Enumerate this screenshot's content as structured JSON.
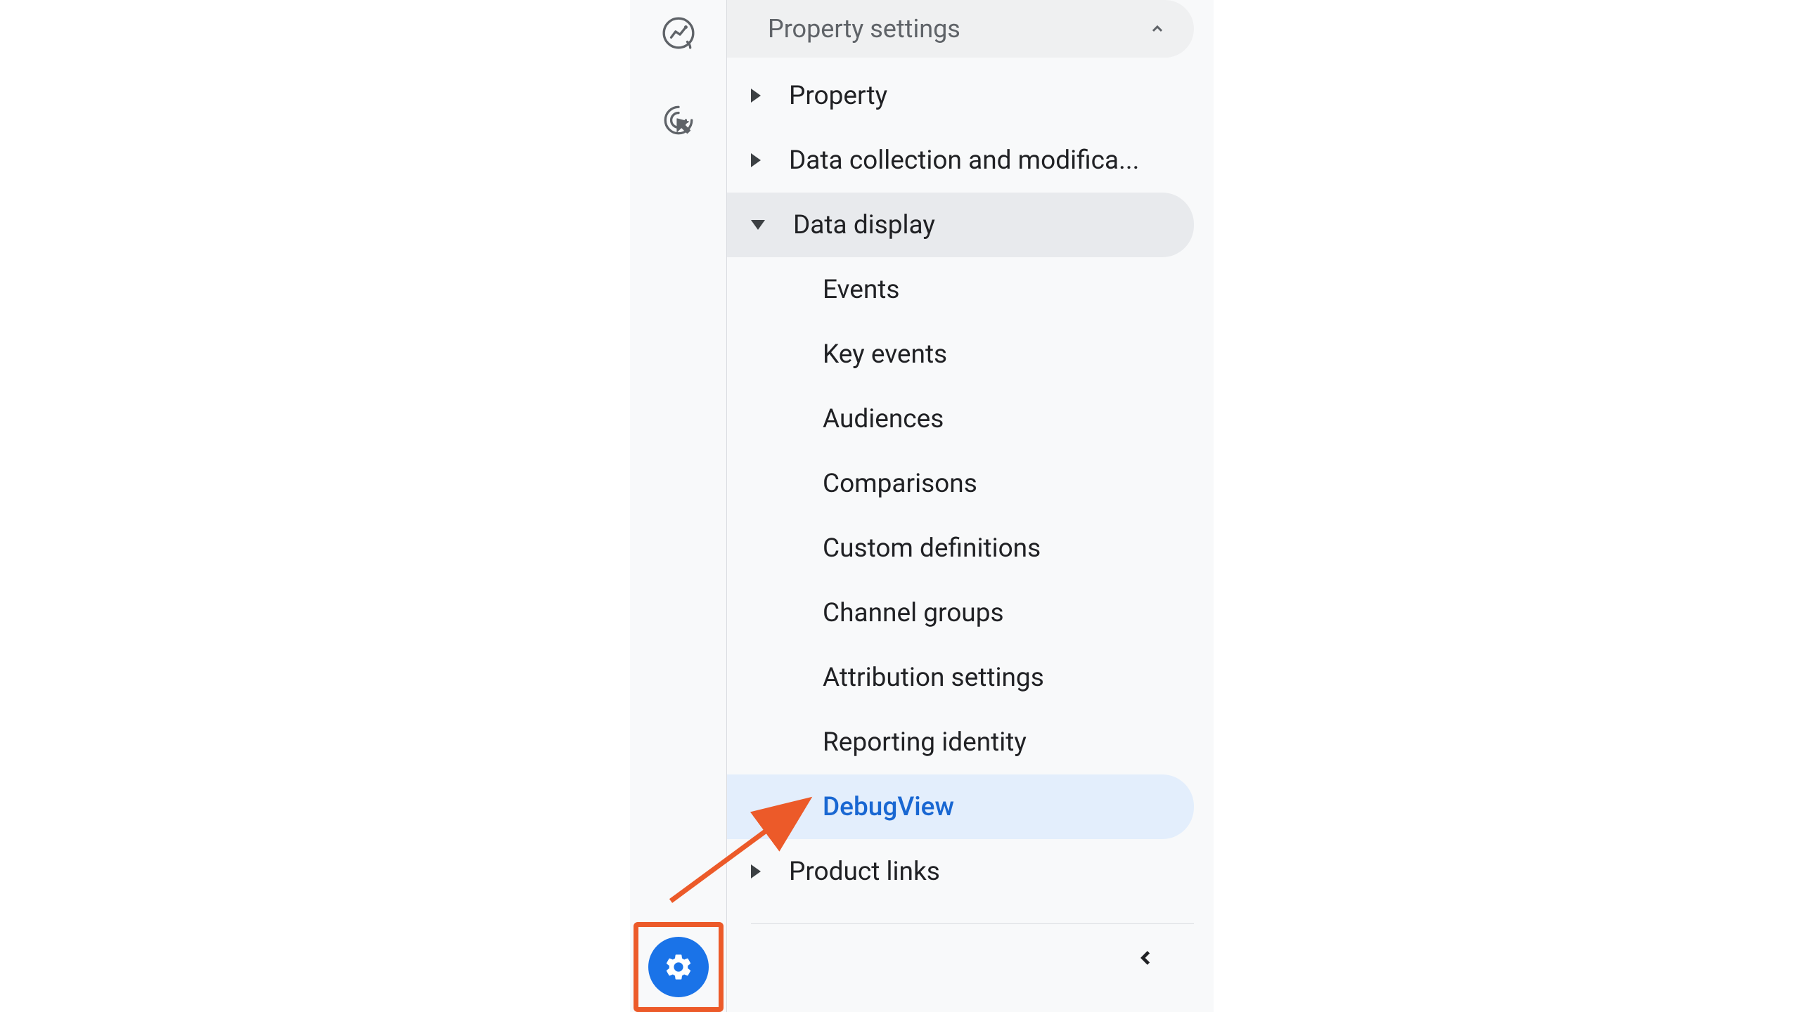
{
  "section_header": "Property settings",
  "nav": {
    "property": "Property",
    "data_collection": "Data collection and modifica...",
    "data_display": "Data display",
    "product_links": "Product links"
  },
  "data_display_items": {
    "events": "Events",
    "key_events": "Key events",
    "audiences": "Audiences",
    "comparisons": "Comparisons",
    "custom_definitions": "Custom definitions",
    "channel_groups": "Channel groups",
    "attribution_settings": "Attribution settings",
    "reporting_identity": "Reporting identity",
    "debugview": "DebugView"
  },
  "colors": {
    "highlight_orange": "#ec5a29",
    "accent_blue": "#1a73e8",
    "link_blue": "#1967d2"
  }
}
